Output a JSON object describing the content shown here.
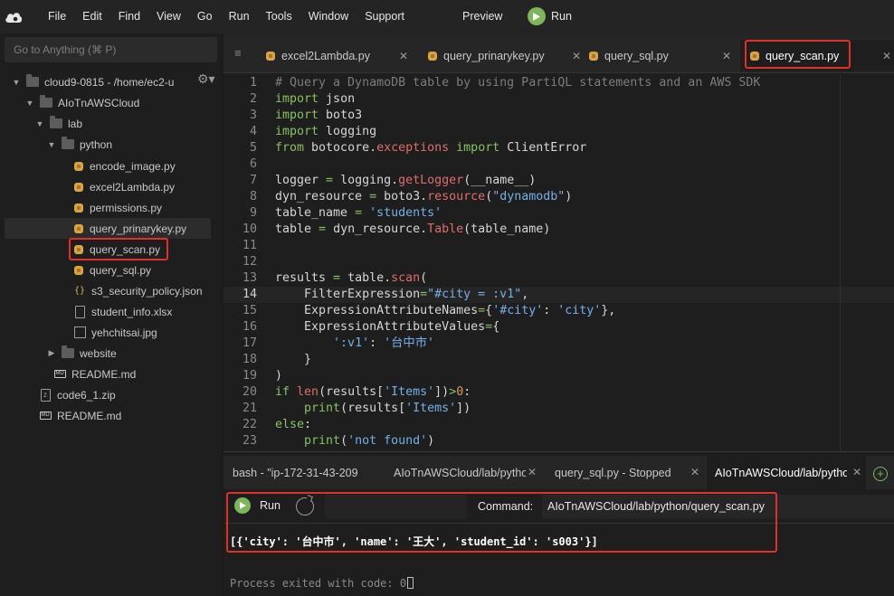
{
  "menubar": {
    "items": [
      "File",
      "Edit",
      "Find",
      "View",
      "Go",
      "Run",
      "Tools",
      "Window",
      "Support"
    ],
    "preview": "Preview",
    "run": "Run"
  },
  "sidebar": {
    "goto_placeholder": "Go to Anything (⌘ P)",
    "tree": [
      {
        "label": "cloud9-0815 - /home/ec2-u",
        "kind": "folder",
        "expanded": true
      },
      {
        "label": "AIoTnAWSCloud",
        "kind": "folder",
        "expanded": true
      },
      {
        "label": "lab",
        "kind": "folder",
        "expanded": true
      },
      {
        "label": "python",
        "kind": "folder",
        "expanded": true
      },
      {
        "label": "encode_image.py",
        "kind": "python"
      },
      {
        "label": "excel2Lambda.py",
        "kind": "python"
      },
      {
        "label": "permissions.py",
        "kind": "python"
      },
      {
        "label": "query_prinarykey.py",
        "kind": "python",
        "selected": true
      },
      {
        "label": "query_scan.py",
        "kind": "python",
        "highlighted": true
      },
      {
        "label": "query_sql.py",
        "kind": "python"
      },
      {
        "label": "s3_security_policy.json",
        "kind": "json"
      },
      {
        "label": "student_info.xlsx",
        "kind": "doc"
      },
      {
        "label": "yehchitsai.jpg",
        "kind": "image"
      },
      {
        "label": "website",
        "kind": "folder",
        "expanded": false
      },
      {
        "label": "README.md",
        "kind": "markdown"
      },
      {
        "label": "code6_1.zip",
        "kind": "zip"
      },
      {
        "label": "README.md",
        "kind": "markdown"
      }
    ]
  },
  "editor": {
    "tabs": [
      {
        "label": "excel2Lambda.py"
      },
      {
        "label": "query_prinarykey.py"
      },
      {
        "label": "query_sql.py"
      },
      {
        "label": "query_scan.py",
        "active": true
      }
    ],
    "line_numbers": [
      "1",
      "2",
      "3",
      "4",
      "5",
      "6",
      "7",
      "8",
      "9",
      "10",
      "11",
      "12",
      "13",
      "14",
      "15",
      "16",
      "17",
      "18",
      "19",
      "20",
      "21",
      "22",
      "23"
    ],
    "current_line": 14
  },
  "bottom": {
    "tabs": [
      {
        "label": "bash - \"ip-172-31-43-209"
      },
      {
        "label": "AIoTnAWSCloud/lab/pytho"
      },
      {
        "label": "query_sql.py - Stopped"
      },
      {
        "label": "AIoTnAWSCloud/lab/pytho",
        "active": true
      }
    ],
    "run_label": "Run",
    "command_label": "Command:",
    "command_value": "AIoTnAWSCloud/lab/python/query_scan.py",
    "output": "[{'city': '台中市', 'name': '王大', 'student_id': 's003'}]",
    "exit_message": "Process exited with code: 0"
  },
  "colors": {
    "highlight": "#e0302a",
    "run_green": "#7fb55a",
    "keyword": "#87c160",
    "string": "#74b0e6",
    "function": "#e06c6c"
  }
}
